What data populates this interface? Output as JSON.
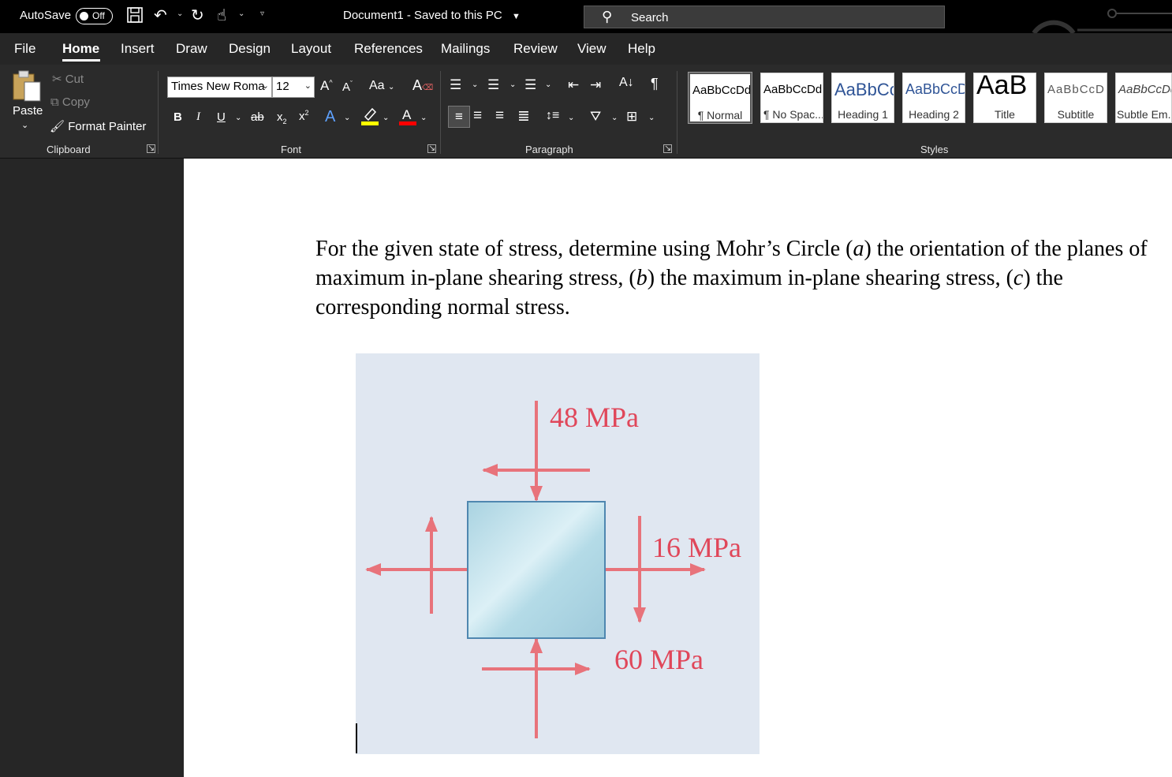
{
  "titlebar": {
    "autosave_label": "AutoSave",
    "autosave_state": "Off",
    "document_title": "Document1  -  Saved to this PC",
    "search_placeholder": "Search"
  },
  "tabs": [
    "File",
    "Home",
    "Insert",
    "Draw",
    "Design",
    "Layout",
    "References",
    "Mailings",
    "Review",
    "View",
    "Help"
  ],
  "active_tab": "Home",
  "clipboard": {
    "paste": "Paste",
    "cut": "Cut",
    "copy": "Copy",
    "format_painter": "Format Painter",
    "label": "Clipboard"
  },
  "font": {
    "family": "Times New Roma",
    "size": "12",
    "case_button": "Aa",
    "label": "Font"
  },
  "paragraph": {
    "label": "Paragraph"
  },
  "styles": {
    "label": "Styles",
    "items": [
      {
        "sample": "AaBbCcDd",
        "name": "¶ Normal"
      },
      {
        "sample": "AaBbCcDd",
        "name": "¶ No Spac..."
      },
      {
        "sample": "AaBbCc",
        "name": "Heading 1"
      },
      {
        "sample": "AaBbCcD",
        "name": "Heading 2"
      },
      {
        "sample": "AaB",
        "name": "Title"
      },
      {
        "sample": "AaBbCcD",
        "name": "Subtitle"
      },
      {
        "sample": "AaBbCcDd",
        "name": "Subtle Em..."
      }
    ]
  },
  "document": {
    "paragraph_parts": {
      "p1": "For the given state of stress, determine using Mohr’s Circle (",
      "a": "a",
      "p2": ") the orientation of the planes of maximum in-plane shearing stress, (",
      "b": "b",
      "p3": ") the maximum in-plane shearing stress, (",
      "c": "c",
      "p4": ") the corresponding normal stress."
    },
    "figure": {
      "label_top": "48 MPa",
      "label_shear": "16 MPa",
      "label_right": "60 MPa"
    }
  },
  "colors": {
    "arrow": "#e8737b",
    "label": "#e0475a",
    "element_fill": "#b9dce8",
    "element_stroke": "#4f87b0"
  }
}
